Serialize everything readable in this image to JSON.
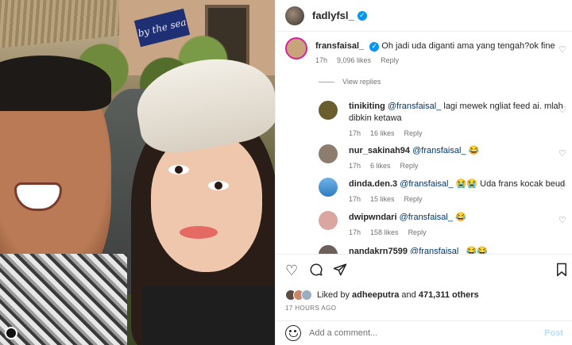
{
  "post": {
    "author": "fadlyfsl_",
    "photo_sign_text": "by the sea"
  },
  "comments": [
    {
      "user": "fransfaisal_",
      "verified": true,
      "mention": "",
      "text": "Oh jadi uda diganti ama yang tengah?ok fine",
      "time": "17h",
      "likes": "9,096 likes",
      "reply": "Reply",
      "view_replies": "View replies",
      "avatar_color": "#c9a37a"
    },
    {
      "user": "tinikiting",
      "mention": "@fransfaisal_",
      "text": "lagi mewek ngliat feed ai. mlah",
      "text2": "dibkin ketawa",
      "time": "17h",
      "likes": "16 likes",
      "reply": "Reply",
      "avatar_color": "#6b5e2e"
    },
    {
      "user": "nur_sakinah94",
      "mention": "@fransfaisal_",
      "text": "😂",
      "time": "17h",
      "likes": "6 likes",
      "reply": "Reply",
      "avatar_color": "#8c7d6f"
    },
    {
      "user": "dinda.den.3",
      "mention": "@fransfaisal_",
      "text": "😭😭 Uda frans kocak beud",
      "time": "17h",
      "likes": "15 likes",
      "reply": "Reply",
      "avatar_color": "#5aa0d8"
    },
    {
      "user": "dwipwndari",
      "mention": "@fransfaisal_",
      "text": "😂",
      "time": "17h",
      "likes": "158 likes",
      "reply": "Reply",
      "avatar_color": "#d9a7a0"
    },
    {
      "user": "nandakrn7599",
      "mention": "@fransfaisal_",
      "text": "😂😂",
      "avatar_color": "#6d6058"
    }
  ],
  "actions": {
    "liked_by_prefix": "Liked by",
    "liked_by_user": "adheeputra",
    "liked_by_and": "and",
    "liked_by_count": "471,311 others",
    "time_ago": "17 HOURS AGO"
  },
  "composer": {
    "placeholder": "Add a comment...",
    "post_label": "Post"
  }
}
